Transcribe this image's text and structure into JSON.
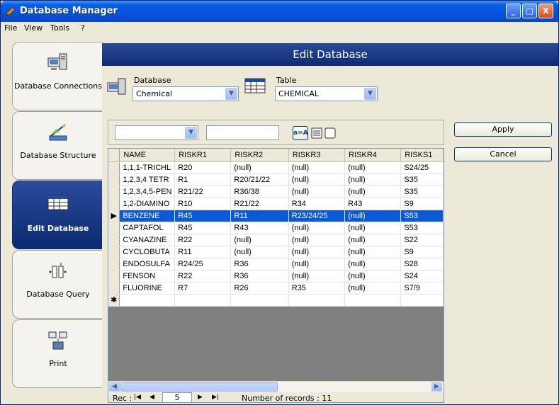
{
  "window": {
    "title": "Database Manager",
    "minimize_glyph": "_",
    "maximize_glyph": "□",
    "close_glyph": "X"
  },
  "menu": [
    "File",
    "View",
    "Tools",
    "?"
  ],
  "nav": [
    {
      "label": "Database Connections",
      "icon": "database-connections-icon"
    },
    {
      "label": "Database Structure",
      "icon": "database-structure-icon"
    },
    {
      "label": "Edit Database",
      "icon": "edit-database-icon",
      "active": true
    },
    {
      "label": "Database Query",
      "icon": "database-query-icon"
    },
    {
      "label": "Print",
      "icon": "print-icon"
    }
  ],
  "panel": {
    "title": "Edit Database"
  },
  "database": {
    "label": "Database",
    "value": "Chemical"
  },
  "table": {
    "label": "Table",
    "value": "CHEMICAL"
  },
  "filter": {
    "field_value": "",
    "text_value": "",
    "case_button": "a=A"
  },
  "buttons": {
    "apply": "Apply",
    "cancel": "Cancel"
  },
  "grid": {
    "columns": [
      "NAME",
      "RISKR1",
      "RISKR2",
      "RISKR3",
      "RISKR4",
      "RISKS1"
    ],
    "rows": [
      [
        "1,1,1-TRICHL",
        "R20",
        "(null)",
        "(null)",
        "(null)",
        "S24/25"
      ],
      [
        "1,2,3,4 TETR",
        "R1",
        "R20/21/22",
        "(null)",
        "(null)",
        "S35"
      ],
      [
        "1,2,3,4,5-PEN",
        "R21/22",
        "R36/38",
        "(null)",
        "(null)",
        "S35"
      ],
      [
        "1,2-DIAMINO",
        "R10",
        "R21/22",
        "R34",
        "R43",
        "S9"
      ],
      [
        "BENZENE",
        "R45",
        "R11",
        "R23/24/25",
        "(null)",
        "S53"
      ],
      [
        "CAPTAFOL",
        "R45",
        "R43",
        "(null)",
        "(null)",
        "S53"
      ],
      [
        "CYANAZINE",
        "R22",
        "(null)",
        "(null)",
        "(null)",
        "S22"
      ],
      [
        "CYCLOBUTA",
        "R11",
        "(null)",
        "(null)",
        "(null)",
        "S9"
      ],
      [
        "ENDOSULFA",
        "R24/25",
        "R36",
        "(null)",
        "(null)",
        "S28"
      ],
      [
        "FENSON",
        "R22",
        "R36",
        "(null)",
        "(null)",
        "S24"
      ],
      [
        "FLUORINE",
        "R7",
        "R26",
        "R35",
        "(null)",
        "S7/9"
      ]
    ],
    "selected_row": 4,
    "current_row_marker": "▶",
    "new_row_marker": "✱"
  },
  "navigator": {
    "rec_label": "Rec :",
    "current": "5",
    "records_label": "Number of records : 11"
  }
}
